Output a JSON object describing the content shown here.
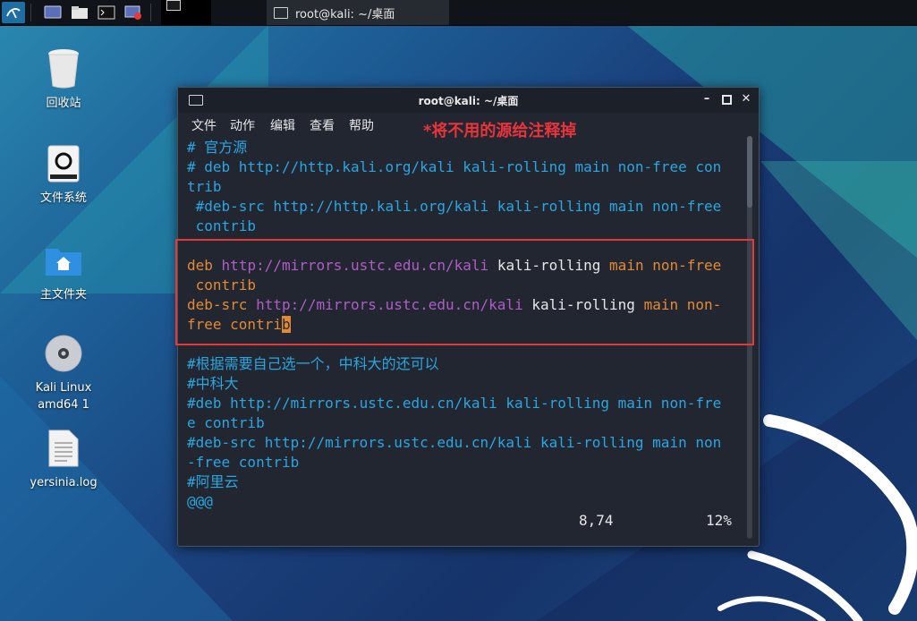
{
  "panel": {
    "task_title": "root@kali: ~/桌面"
  },
  "desktop_icons": [
    {
      "label": "回收站",
      "icon": "trash-icon"
    },
    {
      "label": "文件系统",
      "icon": "drive-icon"
    },
    {
      "label": "主文件夹",
      "icon": "home-folder-icon"
    },
    {
      "label": "Kali Linux amd64 1",
      "line1": "Kali Linux",
      "line2": "amd64 1",
      "icon": "disc-icon"
    },
    {
      "label": "yersinia.log",
      "icon": "text-file-icon"
    }
  ],
  "terminal": {
    "title": "root@kali: ~/桌面",
    "menu": [
      "文件",
      "动作",
      "编辑",
      "查看",
      "帮助"
    ],
    "annotation": "*将不用的源给注释掉",
    "lines": {
      "l1": "# 官方源",
      "l2": "# deb http://http.kali.org/kali kali-rolling main non-free con",
      "l3": "trib",
      "l4": " #deb-src http://http.kali.org/kali kali-rolling main non-free",
      "l5": " contrib",
      "l7_kw": "deb",
      "l7_url": "http://mirrors.ustc.edu.cn/kali",
      "l7_dist": "kali-rolling",
      "l7_comp": "main non-free",
      "l8": " contrib",
      "l9_kw": "deb-src",
      "l9_url": "http://mirrors.ustc.edu.cn/kali",
      "l9_dist": "kali-rolling",
      "l9_comp": "main non-",
      "l10_a": "free contri",
      "l10_cursor": "b",
      "l11": "#根据需要自己选一个，中科大的还可以",
      "l12": "#中科大",
      "l13": "#deb http://mirrors.ustc.edu.cn/kali kali-rolling main non-fre",
      "l14": "e contrib",
      "l15": "#deb-src http://mirrors.ustc.edu.cn/kali kali-rolling main non",
      "l16": "-free contrib",
      "l17": "#阿里云",
      "l18": "@@@"
    },
    "status_position": "8,74",
    "status_percent": "12%"
  },
  "colors": {
    "comment": "#2aa6e0",
    "keyword": "#e48a34",
    "url": "#b15cc7",
    "highlight_border": "#e23a3a",
    "annotation": "#e8343a"
  }
}
